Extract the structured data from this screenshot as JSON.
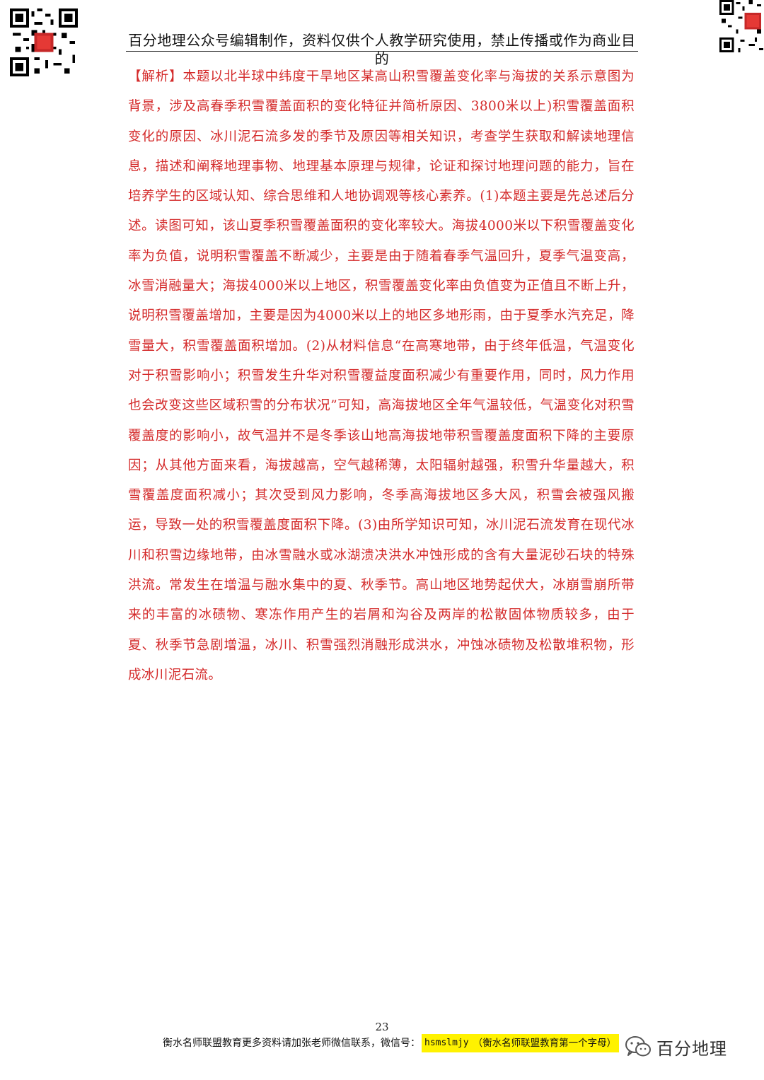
{
  "header": {
    "title": "百分地理公众号编辑制作，资料仅供个人教学研究使用，禁止传播或作为商业目的"
  },
  "qr_codes": {
    "left_icon": "qr-code-icon",
    "right_icon": "qr-code-icon"
  },
  "content": {
    "tag": "【解析】",
    "paragraph": "本题以北半球中纬度干旱地区某高山积雪覆盖变化率与海拔的关系示意图为背景，涉及高春季积雪覆盖面积的变化特征并简析原因、3800米以上)积雪覆盖面积变化的原因、冰川泥石流多发的季节及原因等相关知识，考查学生获取和解读地理信息，描述和阐释地理事物、地理基本原理与规律，论证和探讨地理问题的能力，旨在培养学生的区域认知、综合思维和人地协调观等核心素养。(1)本题主要是先总述后分述。读图可知，该山夏季积雪覆盖面积的变化率较大。海拔4000米以下积雪覆盖变化率为负值，说明积雪覆盖不断减少，主要是由于随着春季气温回升，夏季气温变高，冰雪消融量大；海拔4000米以上地区，积雪覆盖变化率由负值变为正值且不断上升，说明积雪覆盖增加，主要是因为4000米以上的地区多地形雨，由于夏季水汽充足，降雪量大，积雪覆盖面积增加。(2)从材料信息“在高寒地带，由于终年低温，气温变化对于积雪影响小；积雪发生升华对积雪覆益度面积减少有重要作用，同时，风力作用也会改变这些区域积雪的分布状况”可知，高海拔地区全年气温较低，气温变化对积雪覆盖度的影响小，故气温并不是冬季该山地高海拔地带积雪覆盖度面积下降的主要原因；从其他方面来看，海拔越高，空气越稀薄，太阳辐射越强，积雪升华量越大，积雪覆盖度面积减小；其次受到风力影响，冬季高海拔地区多大风，积雪会被强风搬运，导致一处的积雪覆盖度面积下降。(3)由所学知识可知，冰川泥石流发育在现代冰川和积雪边缘地带，由冰雪融水或冰湖溃决洪水冲蚀形成的含有大量泥砂石块的特殊洪流。常发生在增温与融水集中的夏、秋季节。高山地区地势起伏大，冰崩雪崩所带来的丰富的冰碛物、寒冻作用产生的岩屑和沟谷及两岸的松散固体物质较多，由于夏、秋季节急剧增温，冰川、积雪强烈消融形成洪水，冲蚀冰碛物及松散堆积物，形成冰川泥石流。"
  },
  "footer": {
    "page_number": "23",
    "contact_text": "衡水名师联盟教育更多资料请加张老师微信联系，微信号：",
    "wechat_id": "hsmslmjy",
    "wechat_note": "（衡水名师联盟教育第一个字母）",
    "brand_icon": "wechat-icon",
    "brand_name": "百分地理"
  },
  "colors": {
    "body_text": "#d42a2a",
    "highlight": "#fff200"
  }
}
